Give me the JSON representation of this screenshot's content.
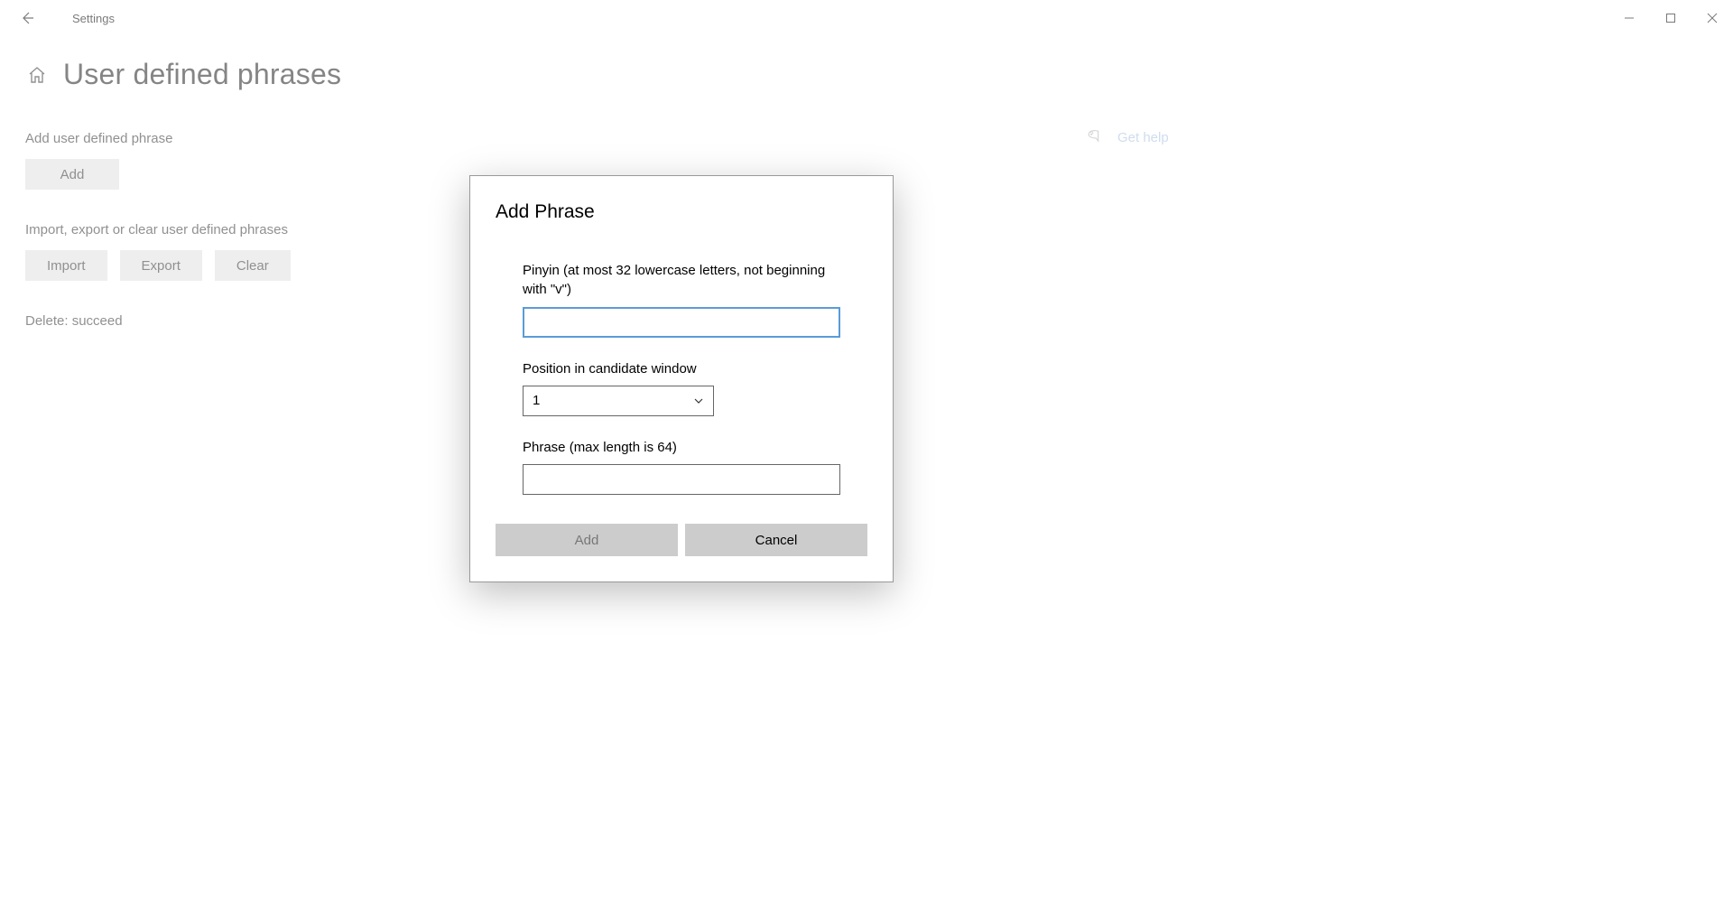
{
  "titlebar": {
    "app_title": "Settings"
  },
  "page": {
    "title": "User defined phrases"
  },
  "sections": {
    "add_label": "Add user defined phrase",
    "add_button": "Add",
    "io_label": "Import, export or clear user defined phrases",
    "import_button": "Import",
    "export_button": "Export",
    "clear_button": "Clear",
    "status": "Delete: succeed"
  },
  "help": {
    "label": "Get help"
  },
  "dialog": {
    "title": "Add Phrase",
    "pinyin_label": "Pinyin (at most 32 lowercase letters, not beginning with \"v\")",
    "pinyin_value": "",
    "position_label": "Position in candidate window",
    "position_value": "1",
    "phrase_label": "Phrase (max length is 64)",
    "phrase_value": "",
    "add_button": "Add",
    "cancel_button": "Cancel"
  }
}
